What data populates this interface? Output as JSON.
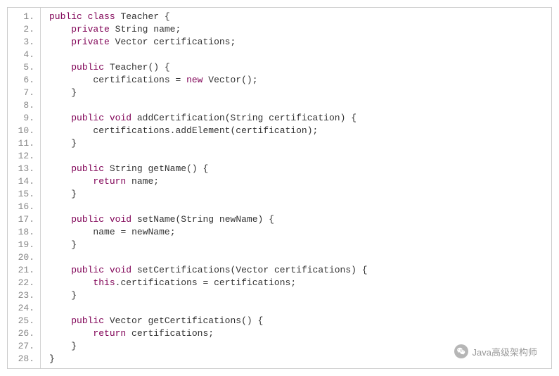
{
  "watermark": "Java高级架构师",
  "lines": [
    {
      "n": "1.",
      "tokens": [
        {
          "t": "kw",
          "v": "public"
        },
        {
          "t": "sp",
          "v": " "
        },
        {
          "t": "kw",
          "v": "class"
        },
        {
          "t": "sp",
          "v": " "
        },
        {
          "t": "cls",
          "v": "Teacher"
        },
        {
          "t": "sp",
          "v": " "
        },
        {
          "t": "pun",
          "v": "{"
        }
      ]
    },
    {
      "n": "2.",
      "indent": 1,
      "tokens": [
        {
          "t": "kw",
          "v": "private"
        },
        {
          "t": "sp",
          "v": " "
        },
        {
          "t": "typ",
          "v": "String"
        },
        {
          "t": "sp",
          "v": " "
        },
        {
          "t": "id",
          "v": "name"
        },
        {
          "t": "pun",
          "v": ";"
        }
      ]
    },
    {
      "n": "3.",
      "indent": 1,
      "tokens": [
        {
          "t": "kw",
          "v": "private"
        },
        {
          "t": "sp",
          "v": " "
        },
        {
          "t": "typ",
          "v": "Vector"
        },
        {
          "t": "sp",
          "v": " "
        },
        {
          "t": "id",
          "v": "certifications"
        },
        {
          "t": "pun",
          "v": ";"
        }
      ]
    },
    {
      "n": "4.",
      "indent": 0,
      "tokens": []
    },
    {
      "n": "5.",
      "indent": 1,
      "tokens": [
        {
          "t": "kw",
          "v": "public"
        },
        {
          "t": "sp",
          "v": " "
        },
        {
          "t": "cls",
          "v": "Teacher"
        },
        {
          "t": "pun",
          "v": "()"
        },
        {
          "t": "sp",
          "v": " "
        },
        {
          "t": "pun",
          "v": "{"
        }
      ]
    },
    {
      "n": "6.",
      "indent": 2,
      "tokens": [
        {
          "t": "id",
          "v": "certifications"
        },
        {
          "t": "sp",
          "v": " "
        },
        {
          "t": "pun",
          "v": "="
        },
        {
          "t": "sp",
          "v": " "
        },
        {
          "t": "kw",
          "v": "new"
        },
        {
          "t": "sp",
          "v": " "
        },
        {
          "t": "typ",
          "v": "Vector"
        },
        {
          "t": "pun",
          "v": "();"
        }
      ]
    },
    {
      "n": "7.",
      "indent": 1,
      "tokens": [
        {
          "t": "pun",
          "v": "}"
        }
      ]
    },
    {
      "n": "8.",
      "indent": 0,
      "tokens": []
    },
    {
      "n": "9.",
      "indent": 1,
      "tokens": [
        {
          "t": "kw",
          "v": "public"
        },
        {
          "t": "sp",
          "v": " "
        },
        {
          "t": "kw",
          "v": "void"
        },
        {
          "t": "sp",
          "v": " "
        },
        {
          "t": "id",
          "v": "addCertification"
        },
        {
          "t": "pun",
          "v": "("
        },
        {
          "t": "typ",
          "v": "String"
        },
        {
          "t": "sp",
          "v": " "
        },
        {
          "t": "id",
          "v": "certification"
        },
        {
          "t": "pun",
          "v": ")"
        },
        {
          "t": "sp",
          "v": " "
        },
        {
          "t": "pun",
          "v": "{"
        }
      ]
    },
    {
      "n": "10.",
      "indent": 2,
      "tokens": [
        {
          "t": "id",
          "v": "certifications"
        },
        {
          "t": "pun",
          "v": "."
        },
        {
          "t": "id",
          "v": "addElement"
        },
        {
          "t": "pun",
          "v": "("
        },
        {
          "t": "id",
          "v": "certification"
        },
        {
          "t": "pun",
          "v": ");"
        }
      ]
    },
    {
      "n": "11.",
      "indent": 1,
      "tokens": [
        {
          "t": "pun",
          "v": "}"
        }
      ]
    },
    {
      "n": "12.",
      "indent": 0,
      "tokens": []
    },
    {
      "n": "13.",
      "indent": 1,
      "tokens": [
        {
          "t": "kw",
          "v": "public"
        },
        {
          "t": "sp",
          "v": " "
        },
        {
          "t": "typ",
          "v": "String"
        },
        {
          "t": "sp",
          "v": " "
        },
        {
          "t": "id",
          "v": "getName"
        },
        {
          "t": "pun",
          "v": "()"
        },
        {
          "t": "sp",
          "v": " "
        },
        {
          "t": "pun",
          "v": "{"
        }
      ]
    },
    {
      "n": "14.",
      "indent": 2,
      "tokens": [
        {
          "t": "kw",
          "v": "return"
        },
        {
          "t": "sp",
          "v": " "
        },
        {
          "t": "id",
          "v": "name"
        },
        {
          "t": "pun",
          "v": ";"
        }
      ]
    },
    {
      "n": "15.",
      "indent": 1,
      "tokens": [
        {
          "t": "pun",
          "v": "}"
        }
      ]
    },
    {
      "n": "16.",
      "indent": 0,
      "tokens": []
    },
    {
      "n": "17.",
      "indent": 1,
      "tokens": [
        {
          "t": "kw",
          "v": "public"
        },
        {
          "t": "sp",
          "v": " "
        },
        {
          "t": "kw",
          "v": "void"
        },
        {
          "t": "sp",
          "v": " "
        },
        {
          "t": "id",
          "v": "setName"
        },
        {
          "t": "pun",
          "v": "("
        },
        {
          "t": "typ",
          "v": "String"
        },
        {
          "t": "sp",
          "v": " "
        },
        {
          "t": "id",
          "v": "newName"
        },
        {
          "t": "pun",
          "v": ")"
        },
        {
          "t": "sp",
          "v": " "
        },
        {
          "t": "pun",
          "v": "{"
        }
      ]
    },
    {
      "n": "18.",
      "indent": 2,
      "tokens": [
        {
          "t": "id",
          "v": "name"
        },
        {
          "t": "sp",
          "v": " "
        },
        {
          "t": "pun",
          "v": "="
        },
        {
          "t": "sp",
          "v": " "
        },
        {
          "t": "id",
          "v": "newName"
        },
        {
          "t": "pun",
          "v": ";"
        }
      ]
    },
    {
      "n": "19.",
      "indent": 1,
      "tokens": [
        {
          "t": "pun",
          "v": "}"
        }
      ]
    },
    {
      "n": "20.",
      "indent": 0,
      "tokens": []
    },
    {
      "n": "21.",
      "indent": 1,
      "tokens": [
        {
          "t": "kw",
          "v": "public"
        },
        {
          "t": "sp",
          "v": " "
        },
        {
          "t": "kw",
          "v": "void"
        },
        {
          "t": "sp",
          "v": " "
        },
        {
          "t": "id",
          "v": "setCertifications"
        },
        {
          "t": "pun",
          "v": "("
        },
        {
          "t": "typ",
          "v": "Vector"
        },
        {
          "t": "sp",
          "v": " "
        },
        {
          "t": "id",
          "v": "certifications"
        },
        {
          "t": "pun",
          "v": ")"
        },
        {
          "t": "sp",
          "v": " "
        },
        {
          "t": "pun",
          "v": "{"
        }
      ]
    },
    {
      "n": "22.",
      "indent": 2,
      "tokens": [
        {
          "t": "kw",
          "v": "this"
        },
        {
          "t": "pun",
          "v": "."
        },
        {
          "t": "id",
          "v": "certifications"
        },
        {
          "t": "sp",
          "v": " "
        },
        {
          "t": "pun",
          "v": "="
        },
        {
          "t": "sp",
          "v": " "
        },
        {
          "t": "id",
          "v": "certifications"
        },
        {
          "t": "pun",
          "v": ";"
        }
      ]
    },
    {
      "n": "23.",
      "indent": 1,
      "tokens": [
        {
          "t": "pun",
          "v": "}"
        }
      ]
    },
    {
      "n": "24.",
      "indent": 0,
      "tokens": []
    },
    {
      "n": "25.",
      "indent": 1,
      "tokens": [
        {
          "t": "kw",
          "v": "public"
        },
        {
          "t": "sp",
          "v": " "
        },
        {
          "t": "typ",
          "v": "Vector"
        },
        {
          "t": "sp",
          "v": " "
        },
        {
          "t": "id",
          "v": "getCertifications"
        },
        {
          "t": "pun",
          "v": "()"
        },
        {
          "t": "sp",
          "v": " "
        },
        {
          "t": "pun",
          "v": "{"
        }
      ]
    },
    {
      "n": "26.",
      "indent": 2,
      "tokens": [
        {
          "t": "kw",
          "v": "return"
        },
        {
          "t": "sp",
          "v": " "
        },
        {
          "t": "id",
          "v": "certifications"
        },
        {
          "t": "pun",
          "v": ";"
        }
      ]
    },
    {
      "n": "27.",
      "indent": 1,
      "tokens": [
        {
          "t": "pun",
          "v": "}"
        }
      ]
    },
    {
      "n": "28.",
      "indent": 0,
      "tokens": [
        {
          "t": "pun",
          "v": "}"
        }
      ]
    }
  ]
}
